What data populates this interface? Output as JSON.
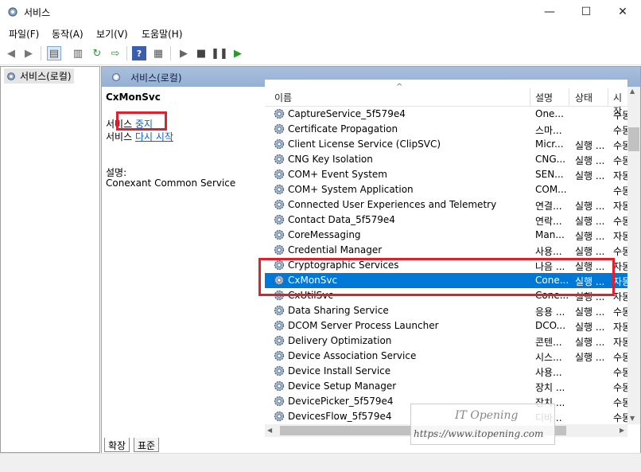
{
  "window": {
    "title": "서비스",
    "minimize": "—",
    "maximize": "☐",
    "close": "✕"
  },
  "menu": [
    "파일(F)",
    "동작(A)",
    "보기(V)",
    "도움말(H)"
  ],
  "tree": {
    "root_label": "서비스(로컬)"
  },
  "pane_header": "서비스(로컬)",
  "detail": {
    "service_name": "CxMonSvc",
    "stop_prefix": "서비스",
    "stop_link": "중지",
    "restart_prefix": "서비스",
    "restart_link": "다시 시작",
    "desc_label": "설명:",
    "desc_text": "Conexant Common Service"
  },
  "columns": {
    "name": "이름",
    "desc": "설명",
    "status": "상태",
    "startup": "시작"
  },
  "services": [
    {
      "name": "CaptureService_5f579e4",
      "desc": "One...",
      "status": "",
      "startup": "수동"
    },
    {
      "name": "Certificate Propagation",
      "desc": "스마...",
      "status": "",
      "startup": "수동"
    },
    {
      "name": "Client License Service (ClipSVC)",
      "desc": "Micr...",
      "status": "실행 ...",
      "startup": "수동"
    },
    {
      "name": "CNG Key Isolation",
      "desc": "CNG...",
      "status": "실행 ...",
      "startup": "수동"
    },
    {
      "name": "COM+ Event System",
      "desc": "SEN...",
      "status": "실행 ...",
      "startup": "자동"
    },
    {
      "name": "COM+ System Application",
      "desc": "COM...",
      "status": "",
      "startup": "수동"
    },
    {
      "name": "Connected User Experiences and Telemetry",
      "desc": "연결...",
      "status": "실행 ...",
      "startup": "자동"
    },
    {
      "name": "Contact Data_5f579e4",
      "desc": "연락...",
      "status": "실행 ...",
      "startup": "수동"
    },
    {
      "name": "CoreMessaging",
      "desc": "Man...",
      "status": "실행 ...",
      "startup": "자동"
    },
    {
      "name": "Credential Manager",
      "desc": "사용...",
      "status": "실행 ...",
      "startup": "수동"
    },
    {
      "name": "Cryptographic Services",
      "desc": "나음 ...",
      "status": "실행 ...",
      "startup": "자동"
    },
    {
      "name": "CxMonSvc",
      "desc": "Cone...",
      "status": "실행 ...",
      "startup": "자동"
    },
    {
      "name": "CxUtilSvc",
      "desc": "Cone...",
      "status": "실행 ...",
      "startup": "자동"
    },
    {
      "name": "Data Sharing Service",
      "desc": "응용 ...",
      "status": "실행 ...",
      "startup": "수동"
    },
    {
      "name": "DCOM Server Process Launcher",
      "desc": "DCO...",
      "status": "실행 ...",
      "startup": "자동"
    },
    {
      "name": "Delivery Optimization",
      "desc": "콘텐...",
      "status": "실행 ...",
      "startup": "자동"
    },
    {
      "name": "Device Association Service",
      "desc": "시스...",
      "status": "실행 ...",
      "startup": "수동"
    },
    {
      "name": "Device Install Service",
      "desc": "사용...",
      "status": "",
      "startup": "수동"
    },
    {
      "name": "Device Setup Manager",
      "desc": "장치 ...",
      "status": "",
      "startup": "수동"
    },
    {
      "name": "DevicePicker_5f579e4",
      "desc": "장치 ...",
      "status": "",
      "startup": "수동"
    },
    {
      "name": "DevicesFlow_5f579e4",
      "desc": "디바...",
      "status": "",
      "startup": "수동"
    }
  ],
  "selected_service": "CxMonSvc",
  "tabs": {
    "extended": "확장",
    "standard": "표준"
  },
  "watermark": {
    "brand": "IT Opening",
    "url": "https://www.itopening.com"
  },
  "colors": {
    "selection": "#0078d7",
    "highlight_box": "#e0202a",
    "link": "#0066cc"
  }
}
